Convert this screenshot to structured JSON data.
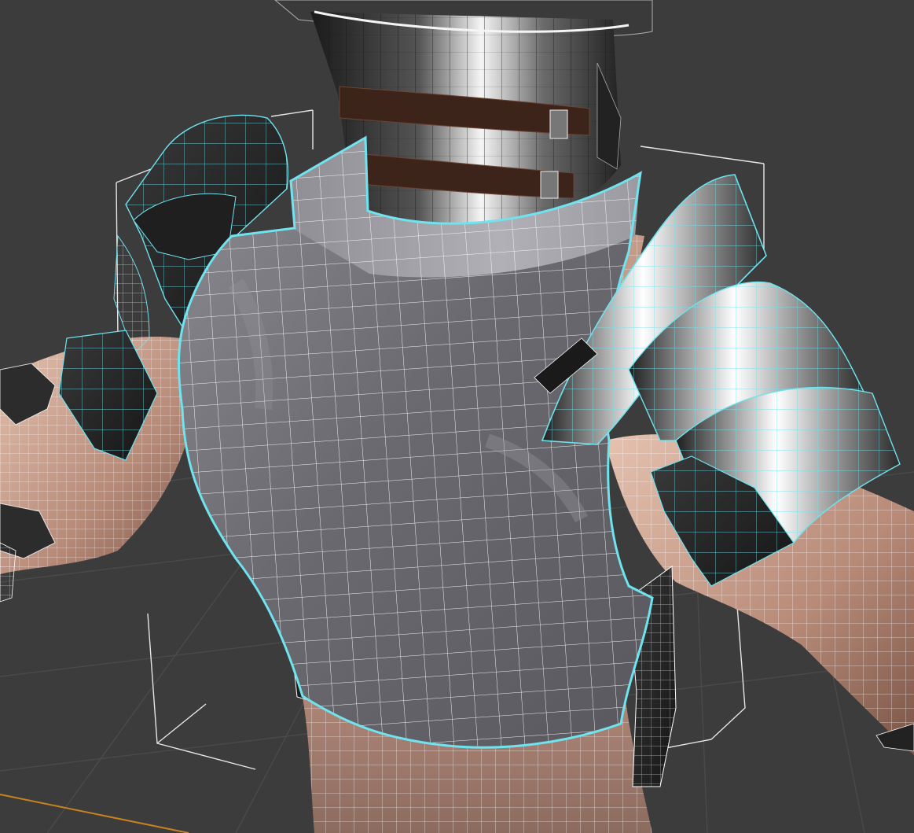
{
  "viewport": {
    "background": "#3c3c3c",
    "grid_color": "#4a4a4a",
    "axis_color": "#c8821e",
    "selection_color": "#6fe3ee",
    "bbox_color": "#e6e6e6",
    "wire_color": "#ffffff"
  },
  "materials": {
    "skin_light": "#d9b2a0",
    "skin_dark": "#8a6355",
    "metal_light": "#f2f2f2",
    "metal_dark": "#2a2a2a",
    "cuirass": "#6f6f73",
    "leather": "#4a2e22"
  },
  "scene": {
    "objects": [
      "helmet",
      "neck-straps",
      "torso",
      "left-arm",
      "right-arm",
      "cuirass",
      "left-pauldron",
      "right-pauldron"
    ],
    "selected": [
      "cuirass",
      "left-pauldron",
      "right-pauldron"
    ]
  }
}
